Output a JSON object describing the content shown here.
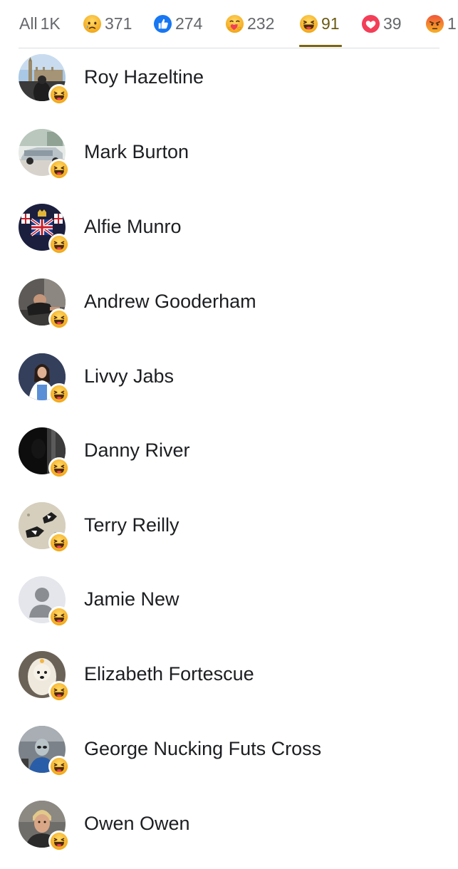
{
  "tabs": [
    {
      "label": "All",
      "count": "1K",
      "icon": "none",
      "active": false
    },
    {
      "label": "",
      "count": "371",
      "icon": "sad-face-icon",
      "active": false
    },
    {
      "label": "",
      "count": "274",
      "icon": "like-thumb-icon",
      "active": false
    },
    {
      "label": "",
      "count": "232",
      "icon": "care-hug-icon",
      "active": false
    },
    {
      "label": "",
      "count": "91",
      "icon": "haha-laugh-icon",
      "active": true
    },
    {
      "label": "",
      "count": "39",
      "icon": "love-heart-icon",
      "active": false
    },
    {
      "label": "",
      "count": "1",
      "icon": "angry-face-icon",
      "active": false
    }
  ],
  "colors": {
    "active_tab": "#7a6511",
    "inactive_tab": "#65676b",
    "like_blue": "#1877f2",
    "love_red": "#f33e58",
    "emoji_yellow": "#f7b125"
  },
  "reactors": [
    {
      "name": "Roy Hazeltine",
      "avatar": "photo-london-parliament",
      "reaction": "haha-laugh-icon"
    },
    {
      "name": "Mark Burton",
      "avatar": "photo-classic-car",
      "reaction": "haha-laugh-icon"
    },
    {
      "name": "Alfie Munro",
      "avatar": "photo-union-jack-crest",
      "reaction": "haha-laugh-icon"
    },
    {
      "name": "Andrew Gooderham",
      "avatar": "photo-man-in-gym",
      "reaction": "haha-laugh-icon"
    },
    {
      "name": "Livvy Jabs",
      "avatar": "photo-woman-portrait",
      "reaction": "haha-laugh-icon"
    },
    {
      "name": "Danny River",
      "avatar": "photo-dark-figure",
      "reaction": "haha-laugh-icon"
    },
    {
      "name": "Terry Reilly",
      "avatar": "photo-collie-dogs",
      "reaction": "haha-laugh-icon"
    },
    {
      "name": "Jamie New",
      "avatar": "default-silhouette",
      "reaction": "haha-laugh-icon"
    },
    {
      "name": "Elizabeth Fortescue",
      "avatar": "photo-white-dog",
      "reaction": "haha-laugh-icon"
    },
    {
      "name": "George Nucking Futs Cross",
      "avatar": "photo-alien-figure",
      "reaction": "haha-laugh-icon"
    },
    {
      "name": "Owen Owen",
      "avatar": "photo-blond-man",
      "reaction": "haha-laugh-icon"
    }
  ]
}
